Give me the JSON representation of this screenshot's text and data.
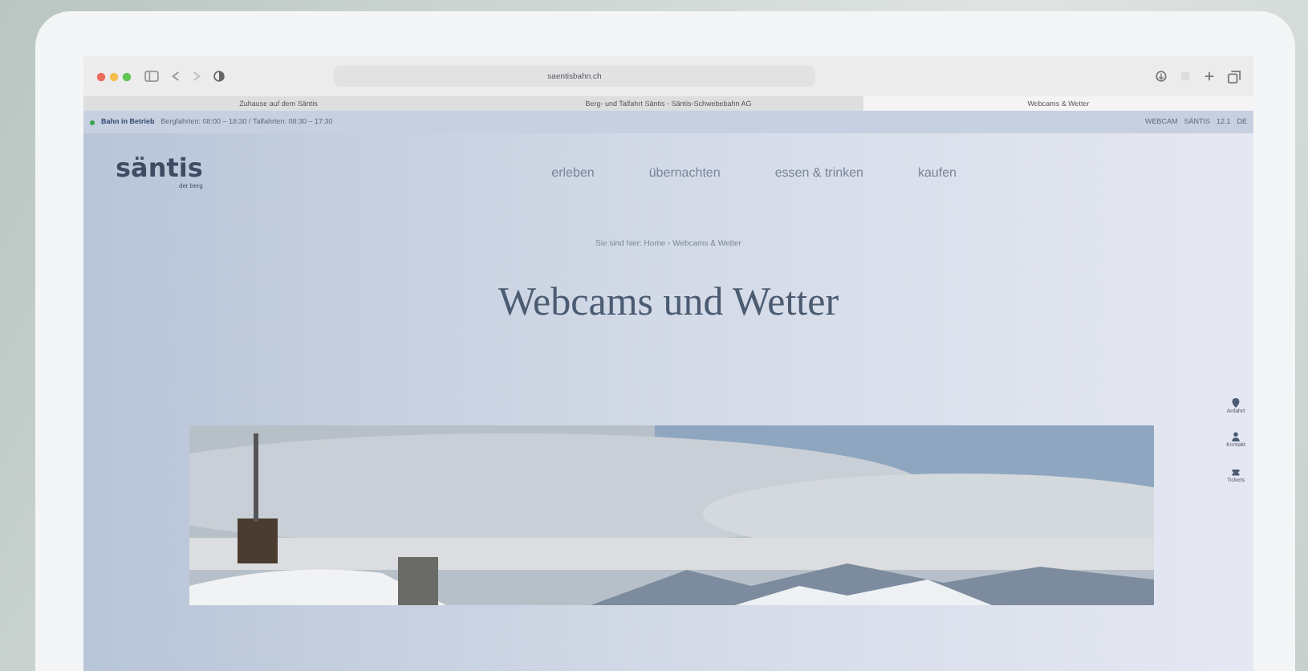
{
  "browser": {
    "url": "saentisbahn.ch",
    "tabs": [
      {
        "title": "Zuhause auf dem Säntis",
        "selected": false
      },
      {
        "title": "Berg- und Talfahrt Säntis - Säntis-Schwebebahn AG",
        "selected": false
      },
      {
        "title": "Webcams & Wetter",
        "selected": true
      }
    ]
  },
  "info_bar": {
    "status": "Bahn in Betrieb",
    "hours": "Bergfahrten: 08:00 – 18:30 / Talfahrten: 08:30 – 17:30",
    "links": [
      "WEBCAM",
      "SÄNTIS",
      "12.1",
      "DE"
    ]
  },
  "site": {
    "logo": "säntis",
    "logo_sub": "der berg",
    "nav": [
      "erleben",
      "übernachten",
      "essen & trinken",
      "kaufen"
    ],
    "breadcrumb": "Sie sind hier: Home › Webcams & Wetter",
    "title": "Webcams und Wetter",
    "side_actions": [
      {
        "label": "Anfahrt",
        "kind": "pin"
      },
      {
        "label": "Kontakt",
        "kind": "person"
      },
      {
        "label": "Tickets",
        "kind": "ticket"
      }
    ]
  }
}
